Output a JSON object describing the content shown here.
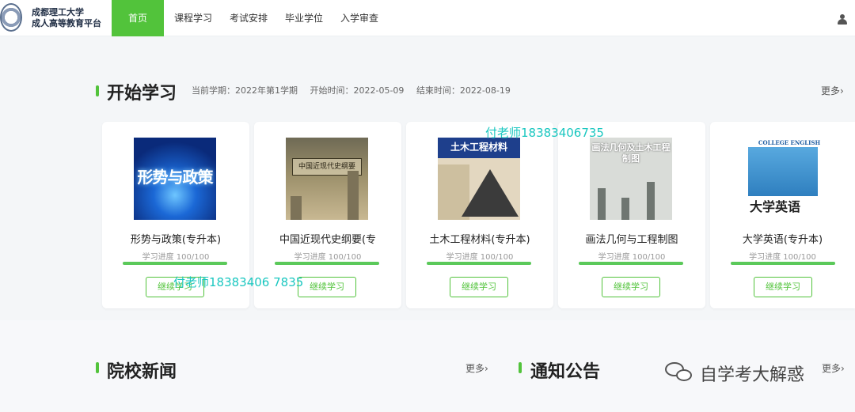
{
  "header": {
    "school_line1": "成都理工大学",
    "school_line2": "成人高等教育平台",
    "nav": [
      "首页",
      "课程学习",
      "考试安排",
      "毕业学位",
      "入学审查"
    ],
    "active_index": 0,
    "user_icon": "user-icon"
  },
  "study": {
    "title": "开始学习",
    "term": "当前学期：2022年第1学期",
    "start": "开始时间：2022-05-09",
    "end": "结束时间：2022-08-19",
    "more": "更多"
  },
  "courses": [
    {
      "name": "形势与政策(专升本)",
      "cover_text": "形势与政策",
      "progress_label": "学习进度 100/100",
      "progress": 1.0,
      "button": "继续学习"
    },
    {
      "name": "中国近现代史纲要(专",
      "cover_text": "中国近现代史纲要",
      "progress_label": "学习进度 100/100",
      "progress": 1.0,
      "button": "继续学习"
    },
    {
      "name": "土木工程材料(专升本)",
      "cover_text": "土木工程材料",
      "progress_label": "学习进度 100/100",
      "progress": 1.0,
      "button": "继续学习"
    },
    {
      "name": "画法几何与工程制图",
      "cover_text": "画法几何及土木工程制图",
      "progress_label": "学习进度 100/100",
      "progress": 1.0,
      "button": "继续学习"
    },
    {
      "name": "大学英语(专升本)",
      "cover_text_top": "COLLEGE ENGLISH",
      "cover_text": "大学英语",
      "progress_label": "学习进度 100/100",
      "progress": 1.0,
      "button": "继续学习"
    }
  ],
  "news": {
    "title": "院校新闻",
    "more": "更多"
  },
  "notice": {
    "title": "通知公告",
    "more": "更多"
  },
  "watermarks": {
    "wm1": "付老师18383406735",
    "wm2": "付老师18383406 7835",
    "brand": "自学考大解惑"
  },
  "colors": {
    "accent": "#52c33b",
    "watermark": "#1ac7c0"
  }
}
